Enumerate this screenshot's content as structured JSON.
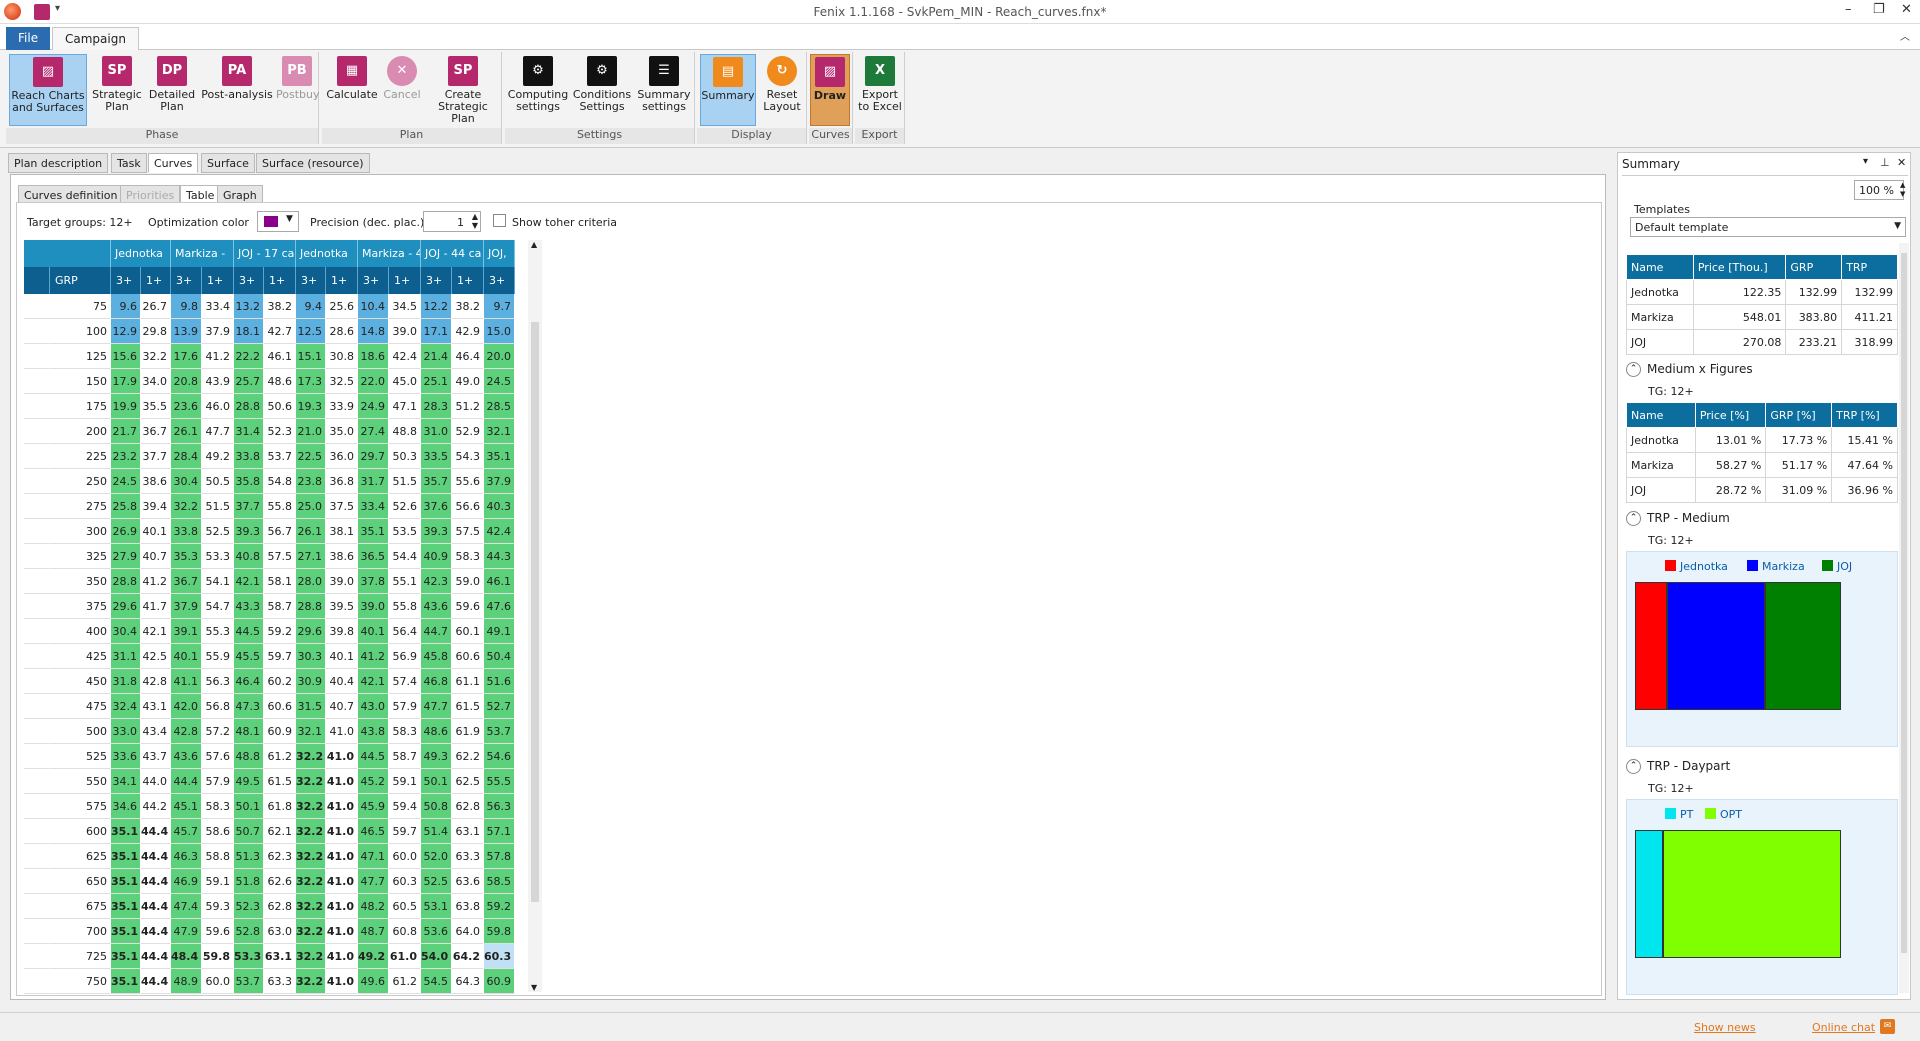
{
  "window": {
    "title": "Fenix 1.1.168 - SvkPem_MIN - Reach_curves.fnx*"
  },
  "menu": {
    "file": "File",
    "campaign": "Campaign"
  },
  "ribbon": {
    "phase_label": "Phase",
    "plan_label": "Plan",
    "settings_label": "Settings",
    "display_label": "Display",
    "curves_label": "Curves",
    "export_label": "Export",
    "buttons": {
      "reach": {
        "l1": "Reach Charts",
        "l2": "and Surfaces"
      },
      "sp": {
        "icon": "SP",
        "l1": "Strategic",
        "l2": "Plan"
      },
      "dp": {
        "icon": "DP",
        "l1": "Detailed",
        "l2": "Plan"
      },
      "pa": {
        "icon": "PA",
        "l1": "Post-analysis",
        "l2": ""
      },
      "pb": {
        "icon": "PB",
        "l1": "Postbuy",
        "l2": ""
      },
      "calc": {
        "l1": "Calculate",
        "l2": ""
      },
      "cancel": {
        "l1": "Cancel",
        "l2": ""
      },
      "create": {
        "icon": "SP",
        "l1": "Create",
        "l2": "Strategic Plan"
      },
      "computing": {
        "l1": "Computing",
        "l2": "settings"
      },
      "conditions": {
        "l1": "Conditions",
        "l2": "Settings"
      },
      "summaryset": {
        "l1": "Summary",
        "l2": "settings"
      },
      "summary": {
        "l1": "Summary",
        "l2": ""
      },
      "reset": {
        "l1": "Reset",
        "l2": "Layout"
      },
      "draw": {
        "l1": "Draw",
        "l2": ""
      },
      "export": {
        "l1": "Export",
        "l2": "to Excel"
      }
    }
  },
  "tabs": [
    "Plan description",
    "Task",
    "Curves",
    "Surface",
    "Surface (resource)"
  ],
  "subtabs": [
    "Curves definition",
    "Priorities",
    "Table",
    "Graph"
  ],
  "options": {
    "target": "Target groups: 12+",
    "opt_color": "Optimization color",
    "opt_color_hex": "#8b008b",
    "precision_label": "Precision (dec. plac.):",
    "precision": "1",
    "show_other": "Show toher criteria"
  },
  "table": {
    "header1": [
      "Jednotka",
      "Markiza -",
      "JOJ - 17 ca",
      "Jednotka",
      "Markiza - 4",
      "JOJ - 44 ca",
      "JOJ,"
    ],
    "grp_label": "GRP",
    "header2": [
      "3+",
      "1+",
      "3+",
      "1+",
      "3+",
      "1+",
      "3+",
      "1+",
      "3+",
      "1+",
      "3+",
      "1+",
      "3+"
    ],
    "rows": [
      [
        "75",
        "9.6",
        "26.7",
        "9.8",
        "33.4",
        "13.2",
        "38.2",
        "9.4",
        "25.6",
        "10.4",
        "34.5",
        "12.2",
        "38.2",
        "9.7"
      ],
      [
        "100",
        "12.9",
        "29.8",
        "13.9",
        "37.9",
        "18.1",
        "42.7",
        "12.5",
        "28.6",
        "14.8",
        "39.0",
        "17.1",
        "42.9",
        "15.0"
      ],
      [
        "125",
        "15.6",
        "32.2",
        "17.6",
        "41.2",
        "22.2",
        "46.1",
        "15.1",
        "30.8",
        "18.6",
        "42.4",
        "21.4",
        "46.4",
        "20.0"
      ],
      [
        "150",
        "17.9",
        "34.0",
        "20.8",
        "43.9",
        "25.7",
        "48.6",
        "17.3",
        "32.5",
        "22.0",
        "45.0",
        "25.1",
        "49.0",
        "24.5"
      ],
      [
        "175",
        "19.9",
        "35.5",
        "23.6",
        "46.0",
        "28.8",
        "50.6",
        "19.3",
        "33.9",
        "24.9",
        "47.1",
        "28.3",
        "51.2",
        "28.5"
      ],
      [
        "200",
        "21.7",
        "36.7",
        "26.1",
        "47.7",
        "31.4",
        "52.3",
        "21.0",
        "35.0",
        "27.4",
        "48.8",
        "31.0",
        "52.9",
        "32.1"
      ],
      [
        "225",
        "23.2",
        "37.7",
        "28.4",
        "49.2",
        "33.8",
        "53.7",
        "22.5",
        "36.0",
        "29.7",
        "50.3",
        "33.5",
        "54.3",
        "35.1"
      ],
      [
        "250",
        "24.5",
        "38.6",
        "30.4",
        "50.5",
        "35.8",
        "54.8",
        "23.8",
        "36.8",
        "31.7",
        "51.5",
        "35.7",
        "55.6",
        "37.9"
      ],
      [
        "275",
        "25.8",
        "39.4",
        "32.2",
        "51.5",
        "37.7",
        "55.8",
        "25.0",
        "37.5",
        "33.4",
        "52.6",
        "37.6",
        "56.6",
        "40.3"
      ],
      [
        "300",
        "26.9",
        "40.1",
        "33.8",
        "52.5",
        "39.3",
        "56.7",
        "26.1",
        "38.1",
        "35.1",
        "53.5",
        "39.3",
        "57.5",
        "42.4"
      ],
      [
        "325",
        "27.9",
        "40.7",
        "35.3",
        "53.3",
        "40.8",
        "57.5",
        "27.1",
        "38.6",
        "36.5",
        "54.4",
        "40.9",
        "58.3",
        "44.3"
      ],
      [
        "350",
        "28.8",
        "41.2",
        "36.7",
        "54.1",
        "42.1",
        "58.1",
        "28.0",
        "39.0",
        "37.8",
        "55.1",
        "42.3",
        "59.0",
        "46.1"
      ],
      [
        "375",
        "29.6",
        "41.7",
        "37.9",
        "54.7",
        "43.3",
        "58.7",
        "28.8",
        "39.5",
        "39.0",
        "55.8",
        "43.6",
        "59.6",
        "47.6"
      ],
      [
        "400",
        "30.4",
        "42.1",
        "39.1",
        "55.3",
        "44.5",
        "59.2",
        "29.6",
        "39.8",
        "40.1",
        "56.4",
        "44.7",
        "60.1",
        "49.1"
      ],
      [
        "425",
        "31.1",
        "42.5",
        "40.1",
        "55.9",
        "45.5",
        "59.7",
        "30.3",
        "40.1",
        "41.2",
        "56.9",
        "45.8",
        "60.6",
        "50.4"
      ],
      [
        "450",
        "31.8",
        "42.8",
        "41.1",
        "56.3",
        "46.4",
        "60.2",
        "30.9",
        "40.4",
        "42.1",
        "57.4",
        "46.8",
        "61.1",
        "51.6"
      ],
      [
        "475",
        "32.4",
        "43.1",
        "42.0",
        "56.8",
        "47.3",
        "60.6",
        "31.5",
        "40.7",
        "43.0",
        "57.9",
        "47.7",
        "61.5",
        "52.7"
      ],
      [
        "500",
        "33.0",
        "43.4",
        "42.8",
        "57.2",
        "48.1",
        "60.9",
        "32.1",
        "41.0",
        "43.8",
        "58.3",
        "48.6",
        "61.9",
        "53.7"
      ],
      [
        "525",
        "33.6",
        "43.7",
        "43.6",
        "57.6",
        "48.8",
        "61.2",
        "32.2",
        "41.0",
        "44.5",
        "58.7",
        "49.3",
        "62.2",
        "54.6"
      ],
      [
        "550",
        "34.1",
        "44.0",
        "44.4",
        "57.9",
        "49.5",
        "61.5",
        "32.2",
        "41.0",
        "45.2",
        "59.1",
        "50.1",
        "62.5",
        "55.5"
      ],
      [
        "575",
        "34.6",
        "44.2",
        "45.1",
        "58.3",
        "50.1",
        "61.8",
        "32.2",
        "41.0",
        "45.9",
        "59.4",
        "50.8",
        "62.8",
        "56.3"
      ],
      [
        "600",
        "35.1",
        "44.4",
        "45.7",
        "58.6",
        "50.7",
        "62.1",
        "32.2",
        "41.0",
        "46.5",
        "59.7",
        "51.4",
        "63.1",
        "57.1"
      ],
      [
        "625",
        "35.1",
        "44.4",
        "46.3",
        "58.8",
        "51.3",
        "62.3",
        "32.2",
        "41.0",
        "47.1",
        "60.0",
        "52.0",
        "63.3",
        "57.8"
      ],
      [
        "650",
        "35.1",
        "44.4",
        "46.9",
        "59.1",
        "51.8",
        "62.6",
        "32.2",
        "41.0",
        "47.7",
        "60.3",
        "52.5",
        "63.6",
        "58.5"
      ],
      [
        "675",
        "35.1",
        "44.4",
        "47.4",
        "59.3",
        "52.3",
        "62.8",
        "32.2",
        "41.0",
        "48.2",
        "60.5",
        "53.1",
        "63.8",
        "59.2"
      ],
      [
        "700",
        "35.1",
        "44.4",
        "47.9",
        "59.6",
        "52.8",
        "63.0",
        "32.2",
        "41.0",
        "48.7",
        "60.8",
        "53.6",
        "64.0",
        "59.8"
      ],
      [
        "725",
        "35.1",
        "44.4",
        "48.4",
        "59.8",
        "53.3",
        "63.1",
        "32.2",
        "41.0",
        "49.2",
        "61.0",
        "54.0",
        "64.2",
        "60.3"
      ],
      [
        "750",
        "35.1",
        "44.4",
        "48.9",
        "60.0",
        "53.7",
        "63.3",
        "32.2",
        "41.0",
        "49.6",
        "61.2",
        "54.5",
        "64.3",
        "60.9"
      ]
    ],
    "colors": {
      "blue": "#5bb0e0",
      "green": "#5cd07a",
      "white": "#ffffff",
      "header": "#1e8fbf",
      "header2": "#0c5f8e"
    }
  },
  "summary": {
    "title": "Summary",
    "zoom": "100 %",
    "templates_label": "Templates",
    "template": "Default template",
    "t1": {
      "headers": [
        "Name",
        "Price [Thou.]",
        "GRP",
        "TRP"
      ],
      "rows": [
        [
          "Jednotka",
          "122.35",
          "132.99",
          "132.99"
        ],
        [
          "Markiza",
          "548.01",
          "383.80",
          "411.21"
        ],
        [
          "JOJ",
          "270.08",
          "233.21",
          "318.99"
        ]
      ]
    },
    "sec2": {
      "title": "Medium x Figures",
      "tg": "TG: 12+",
      "headers": [
        "Name",
        "Price [%]",
        "GRP [%]",
        "TRP [%]"
      ],
      "rows": [
        [
          "Jednotka",
          "13.01 %",
          "17.73 %",
          "15.41 %"
        ],
        [
          "Markiza",
          "58.27 %",
          "51.17 %",
          "47.64 %"
        ],
        [
          "JOJ",
          "28.72 %",
          "31.09 %",
          "36.96 %"
        ]
      ]
    },
    "sec3": {
      "title": "TRP - Medium",
      "tg": "TG: 12+"
    },
    "sec4": {
      "title": "TRP - Daypart",
      "tg": "TG: 12+"
    }
  },
  "chart_data": [
    {
      "type": "bar",
      "categories": [
        "Jednotka",
        "Markiza",
        "JOJ"
      ],
      "values": [
        15.41,
        47.64,
        36.96
      ],
      "colors": [
        "#ff0000",
        "#0000ff",
        "#008000"
      ],
      "legend": "top"
    },
    {
      "type": "bar",
      "categories": [
        "PT",
        "OPT"
      ],
      "values": [
        13.5,
        86.5
      ],
      "colors": [
        "#00e5ee",
        "#7fff00"
      ],
      "legend": "top"
    }
  ],
  "status": {
    "news": "Show news",
    "chat": "Online chat"
  }
}
